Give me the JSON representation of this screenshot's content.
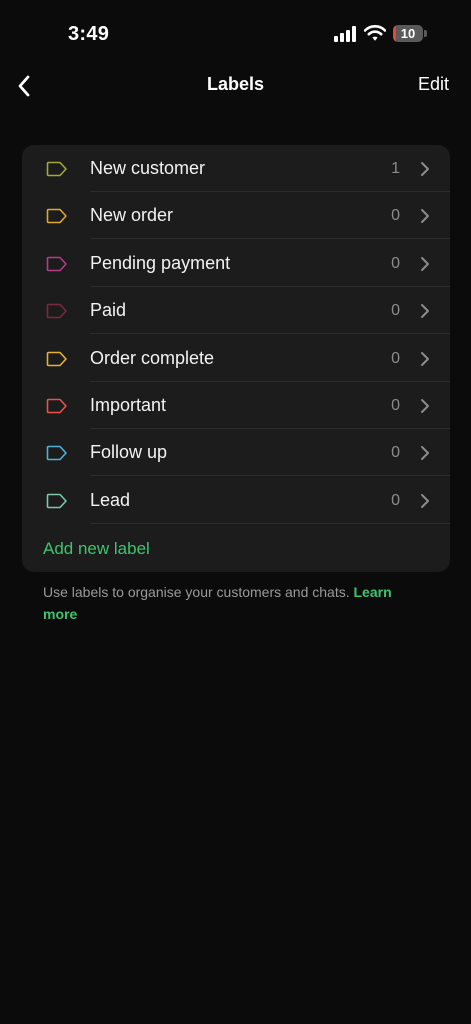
{
  "status_bar": {
    "time": "3:49",
    "battery_level": "10",
    "battery_fraction": 0.1,
    "battery_color": "#e5463a"
  },
  "nav": {
    "back_icon": "chevron-left-icon",
    "title": "Labels",
    "edit_label": "Edit"
  },
  "labels": [
    {
      "name": "New customer",
      "count": "1",
      "color": "#a3a63c"
    },
    {
      "name": "New order",
      "count": "0",
      "color": "#d9a931"
    },
    {
      "name": "Pending payment",
      "count": "0",
      "color": "#b33c86"
    },
    {
      "name": "Paid",
      "count": "0",
      "color": "#7a2a3c"
    },
    {
      "name": "Order complete",
      "count": "0",
      "color": "#e2b13a"
    },
    {
      "name": "Important",
      "count": "0",
      "color": "#e5534b"
    },
    {
      "name": "Follow up",
      "count": "0",
      "color": "#4fb3d9"
    },
    {
      "name": "Lead",
      "count": "0",
      "color": "#7fc7a9"
    }
  ],
  "add_label": "Add new label",
  "footer": {
    "text": "Use labels to organise your customers and chats.",
    "link": "Learn more"
  },
  "colors": {
    "accent": "#3ec46d",
    "background": "#0b0b0b",
    "card": "#1c1c1c"
  }
}
